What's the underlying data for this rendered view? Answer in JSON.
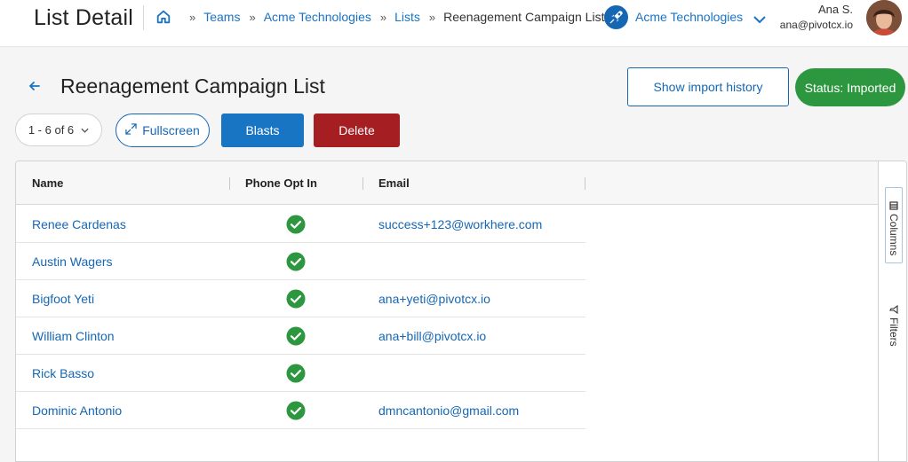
{
  "header": {
    "page_title": "List Detail",
    "breadcrumb": {
      "home_icon": "home-icon",
      "items": [
        "Teams",
        "Acme Technologies",
        "Lists"
      ],
      "current": "Reenagement Campaign List",
      "separator": "»"
    },
    "org": {
      "name": "Acme Technologies",
      "logo_icon": "rocket-icon"
    },
    "user": {
      "name": "Ana S.",
      "email": "ana@pivotcx.io"
    }
  },
  "toolbar": {
    "list_title": "Reenagement Campaign List",
    "show_import_history": "Show import history",
    "status": "Status: Imported",
    "pager": "1 - 6 of 6",
    "fullscreen": "Fullscreen",
    "blasts": "Blasts",
    "delete": "Delete"
  },
  "grid": {
    "columns": [
      "Name",
      "Phone Opt In",
      "Email"
    ],
    "rows": [
      {
        "name": "Renee Cardenas",
        "phone_opt_in": true,
        "email": "success+123@workhere.com"
      },
      {
        "name": "Austin Wagers",
        "phone_opt_in": true,
        "email": ""
      },
      {
        "name": "Bigfoot Yeti",
        "phone_opt_in": true,
        "email": "ana+yeti@pivotcx.io"
      },
      {
        "name": "William Clinton",
        "phone_opt_in": true,
        "email": "ana+bill@pivotcx.io"
      },
      {
        "name": "Rick Basso",
        "phone_opt_in": true,
        "email": ""
      },
      {
        "name": "Dominic Antonio",
        "phone_opt_in": true,
        "email": "dmncantonio@gmail.com"
      }
    ],
    "side_panel": {
      "columns_label": "Columns",
      "filters_label": "Filters"
    }
  },
  "colors": {
    "link_blue": "#1667b3",
    "blasts_blue": "#1875c3",
    "delete_red": "#a41e22",
    "status_green": "#2d9740",
    "check_green": "#2d9740"
  }
}
